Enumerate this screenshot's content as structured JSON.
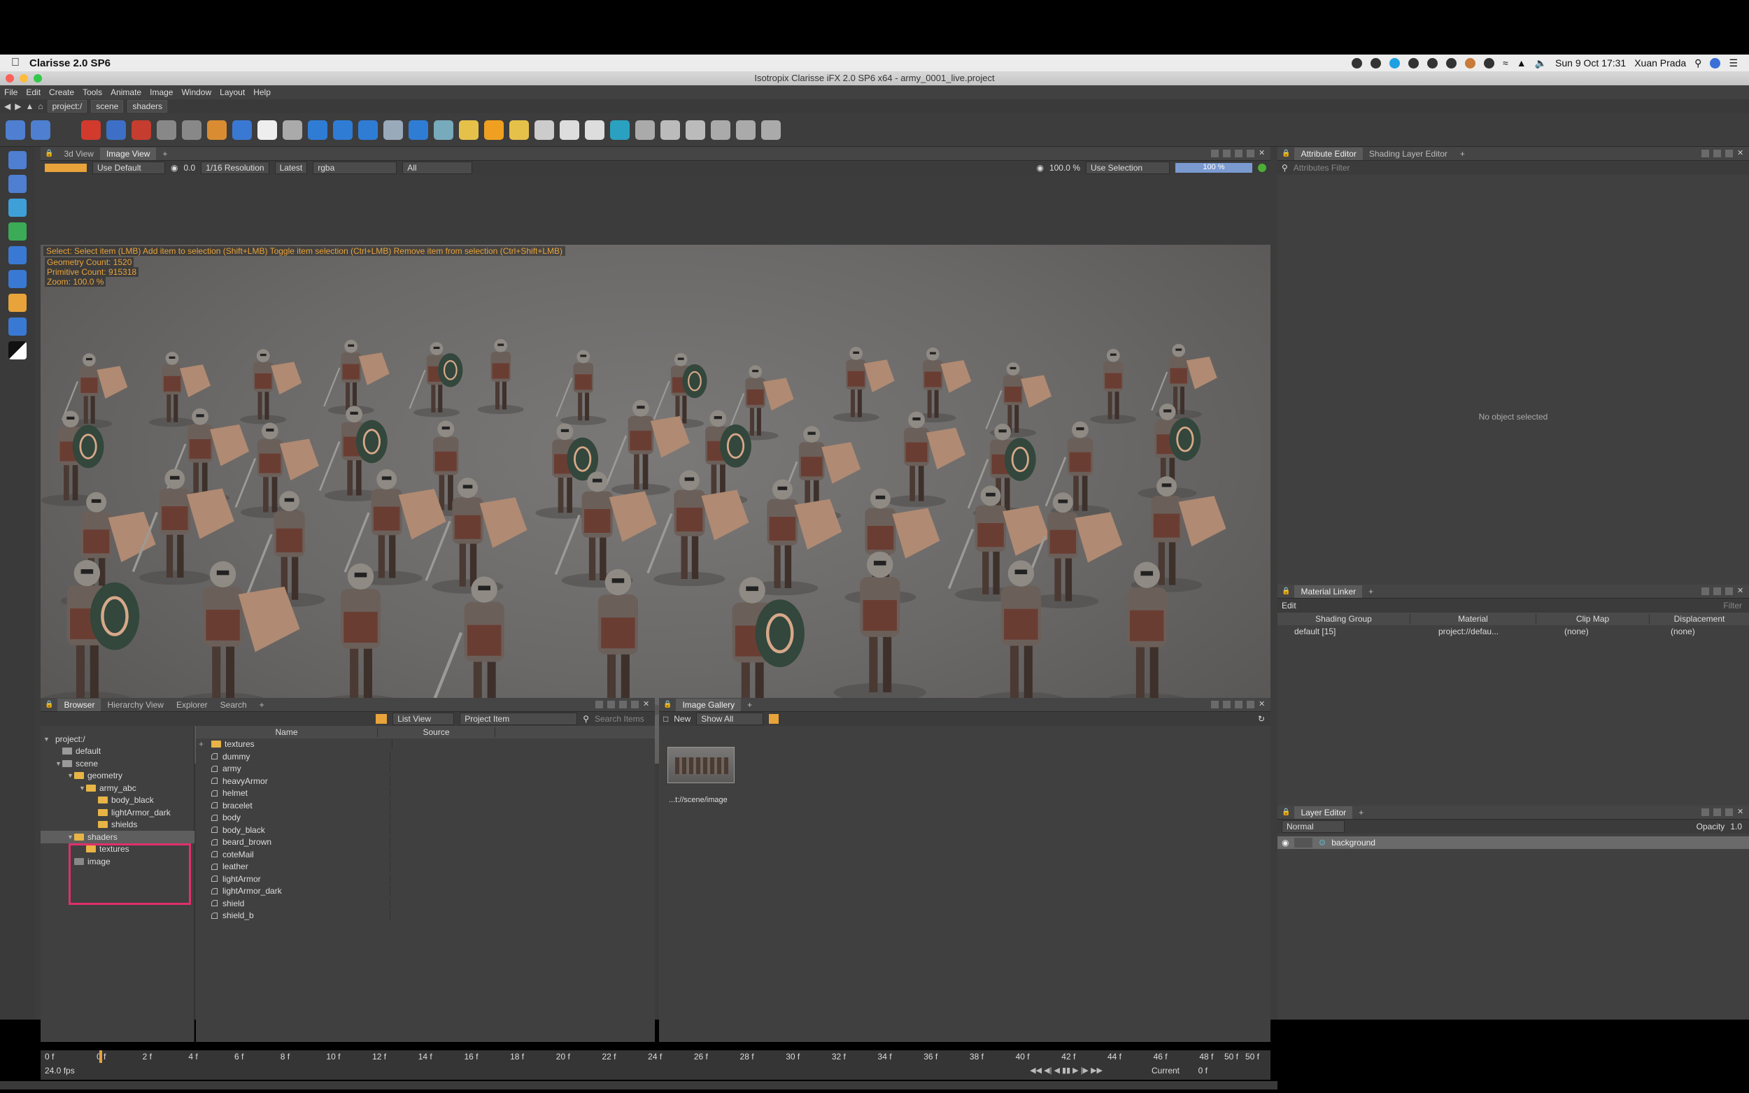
{
  "mac_menubar": {
    "app_name": "Clarisse 2.0 SP6",
    "clock": "Sun 9 Oct  17:31",
    "user": "Xuan Prada"
  },
  "window": {
    "title": "Isotropix Clarisse iFX 2.0 SP6 x64  -  army_0001_live.project",
    "menus": [
      "File",
      "Edit",
      "Create",
      "Tools",
      "Animate",
      "Image",
      "Window",
      "Layout",
      "Help"
    ],
    "breadcrumbs": [
      "project:/",
      "scene",
      "shaders"
    ]
  },
  "viewer": {
    "tabs": [
      "3d View",
      "Image View"
    ],
    "active_tab": "Image View",
    "use_default": "Use Default",
    "value": "0.0",
    "resolution": "1/16 Resolution",
    "latest": "Latest",
    "channel": "rgba",
    "layer": "All",
    "zoom_field": "100.0 %",
    "use_selection": "Use Selection",
    "progress_label": "100 %",
    "progress": 1.0,
    "hint": "Select: Select item (LMB)   Add item to selection (Shift+LMB)   Toggle item selection (Ctrl+LMB)   Remove item from selection (Ctrl+Shift+LMB)",
    "stats": [
      "Geometry Count: 1520",
      "Primitive Count: 915318",
      "Zoom: 100.0 %"
    ]
  },
  "attribute_editor": {
    "tabs": [
      "Attribute Editor",
      "Shading Layer Editor"
    ],
    "filter_placeholder": "Attributes Filter",
    "empty_message": "No object selected"
  },
  "material_linker": {
    "title": "Material Linker",
    "edit_label": "Edit",
    "filter_placeholder": "Filter",
    "columns": [
      "Shading Group",
      "Material",
      "Clip Map",
      "Displacement"
    ],
    "rows": [
      {
        "group": "default [15]",
        "material": "project://defau...",
        "clip": "(none)",
        "disp": "(none)"
      }
    ]
  },
  "layer_editor": {
    "title": "Layer Editor",
    "blend_mode": "Normal",
    "opacity_label": "Opacity",
    "opacity": "1.0",
    "layers": [
      "background"
    ]
  },
  "browser": {
    "tabs": [
      "Browser",
      "Hierarchy View",
      "Explorer",
      "Search"
    ],
    "view_mode": "List View",
    "item_type": "Project Item",
    "search_placeholder": "Search Items",
    "tree": [
      {
        "label": "project:/",
        "depth": 0,
        "type": "root",
        "twisty": "▼"
      },
      {
        "label": "default",
        "depth": 1,
        "type": "ctx",
        "twisty": ""
      },
      {
        "label": "scene",
        "depth": 1,
        "type": "ctx",
        "twisty": "▼"
      },
      {
        "label": "geometry",
        "depth": 2,
        "type": "folder",
        "twisty": "▼"
      },
      {
        "label": "army_abc",
        "depth": 3,
        "type": "folder",
        "twisty": "▼"
      },
      {
        "label": "body_black",
        "depth": 4,
        "type": "folder",
        "twisty": ""
      },
      {
        "label": "lightArmor_dark",
        "depth": 4,
        "type": "folder",
        "twisty": ""
      },
      {
        "label": "shields",
        "depth": 4,
        "type": "folder",
        "twisty": ""
      },
      {
        "label": "shaders",
        "depth": 2,
        "type": "folder",
        "twisty": "▼"
      },
      {
        "label": "textures",
        "depth": 3,
        "type": "folder",
        "twisty": ""
      },
      {
        "label": "image",
        "depth": 2,
        "type": "image",
        "twisty": ""
      }
    ],
    "columns": [
      "Name",
      "Source"
    ],
    "items": [
      "textures",
      "dummy",
      "army",
      "heavyArmor",
      "helmet",
      "bracelet",
      "body",
      "body_black",
      "beard_brown",
      "coteMail",
      "leather",
      "lightArmor",
      "lightArmor_dark",
      "shield",
      "shield_b"
    ]
  },
  "gallery": {
    "title": "Image Gallery",
    "new_label": "New",
    "show": "Show All",
    "caption": "...t://scene/image"
  },
  "timeline": {
    "start": "0 f",
    "end": "50 f",
    "fps": "24.0 fps",
    "current_label": "Current",
    "current": "0 f",
    "ticks": [
      "0 f",
      "2 f",
      "4 f",
      "6 f",
      "8 f",
      "10 f",
      "12 f",
      "14 f",
      "16 f",
      "18 f",
      "20 f",
      "22 f",
      "24 f",
      "26 f",
      "28 f",
      "30 f",
      "32 f",
      "34 f",
      "36 f",
      "38 f",
      "40 f",
      "42 f",
      "44 f",
      "46 f",
      "48 f",
      "50 f"
    ]
  },
  "colors": {
    "accent": "#e8a33a",
    "highlight_box": "#e0306a",
    "folder": "#e7b445",
    "progress": "#7a9ad0"
  }
}
